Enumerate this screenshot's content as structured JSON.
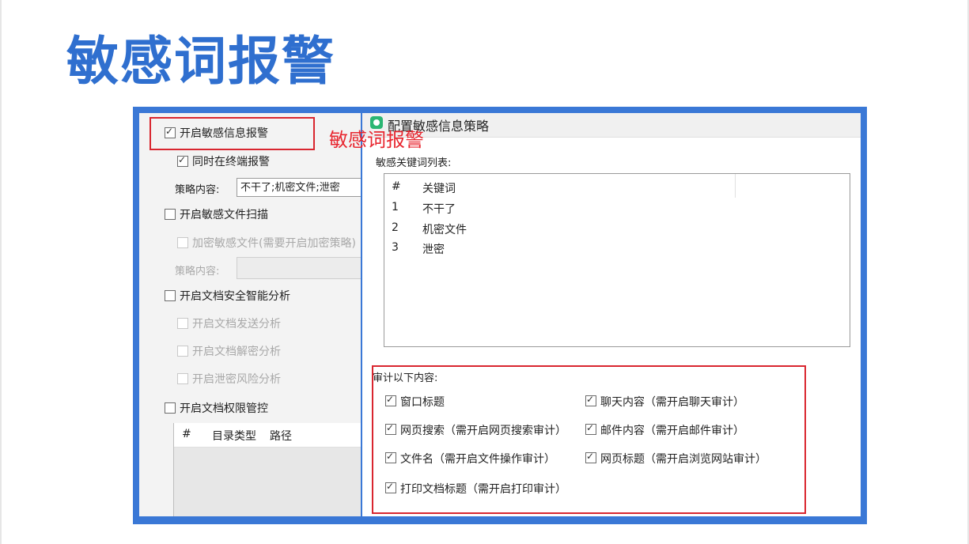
{
  "slide": {
    "title": "敏感词报警"
  },
  "left_panel": {
    "enable_sensitive_alert": {
      "label": "开启敏感信息报警",
      "checked": true
    },
    "alert_on_terminal": {
      "label": "同时在终端报警",
      "checked": true
    },
    "policy_label_1": "策略内容:",
    "policy_value_1": "不干了;机密文件;泄密",
    "enable_file_scan": {
      "label": "开启敏感文件扫描",
      "checked": false
    },
    "encrypt_sensitive_files": {
      "label": "加密敏感文件(需要开启加密策略)",
      "checked": false
    },
    "policy_label_2": "策略内容:",
    "policy_value_2": "",
    "enable_doc_analysis": {
      "label": "开启文档安全智能分析",
      "checked": false
    },
    "doc_send_analysis": {
      "label": "开启文档发送分析",
      "checked": false
    },
    "doc_decrypt_analysis": {
      "label": "开启文档解密分析",
      "checked": false
    },
    "leak_risk_analysis": {
      "label": "开启泄密风险分析",
      "checked": false
    },
    "enable_doc_permission": {
      "label": "开启文档权限管控",
      "checked": false
    },
    "table_headers": [
      "#",
      "目录类型",
      "路径"
    ]
  },
  "annotation": {
    "caption": "敏感词报警",
    "color": "#e8262f"
  },
  "dialog": {
    "title": "配置敏感信息策略",
    "keyword_list_label": "敏感关键词列表:",
    "keyword_table": {
      "headers": [
        "#",
        "关键词"
      ],
      "rows": [
        {
          "index": "1",
          "keyword": "不干了"
        },
        {
          "index": "2",
          "keyword": "机密文件"
        },
        {
          "index": "3",
          "keyword": "泄密"
        }
      ]
    },
    "audit_label": "审计以下内容:",
    "audit_items": [
      {
        "label": "窗口标题",
        "checked": true
      },
      {
        "label": "聊天内容（需开启聊天审计）",
        "checked": true
      },
      {
        "label": "网页搜索（需开启网页搜索审计）",
        "checked": true
      },
      {
        "label": "邮件内容（需开启邮件审计）",
        "checked": true
      },
      {
        "label": "文件名（需开启文件操作审计）",
        "checked": true
      },
      {
        "label": "网页标题（需开启浏览网站审计）",
        "checked": true
      },
      {
        "label": "打印文档标题（需开启打印审计）",
        "checked": true
      }
    ]
  },
  "colors": {
    "title_blue": "#2f6fcf",
    "frame_blue": "#3a78d6",
    "highlight_red": "#d9262f"
  }
}
